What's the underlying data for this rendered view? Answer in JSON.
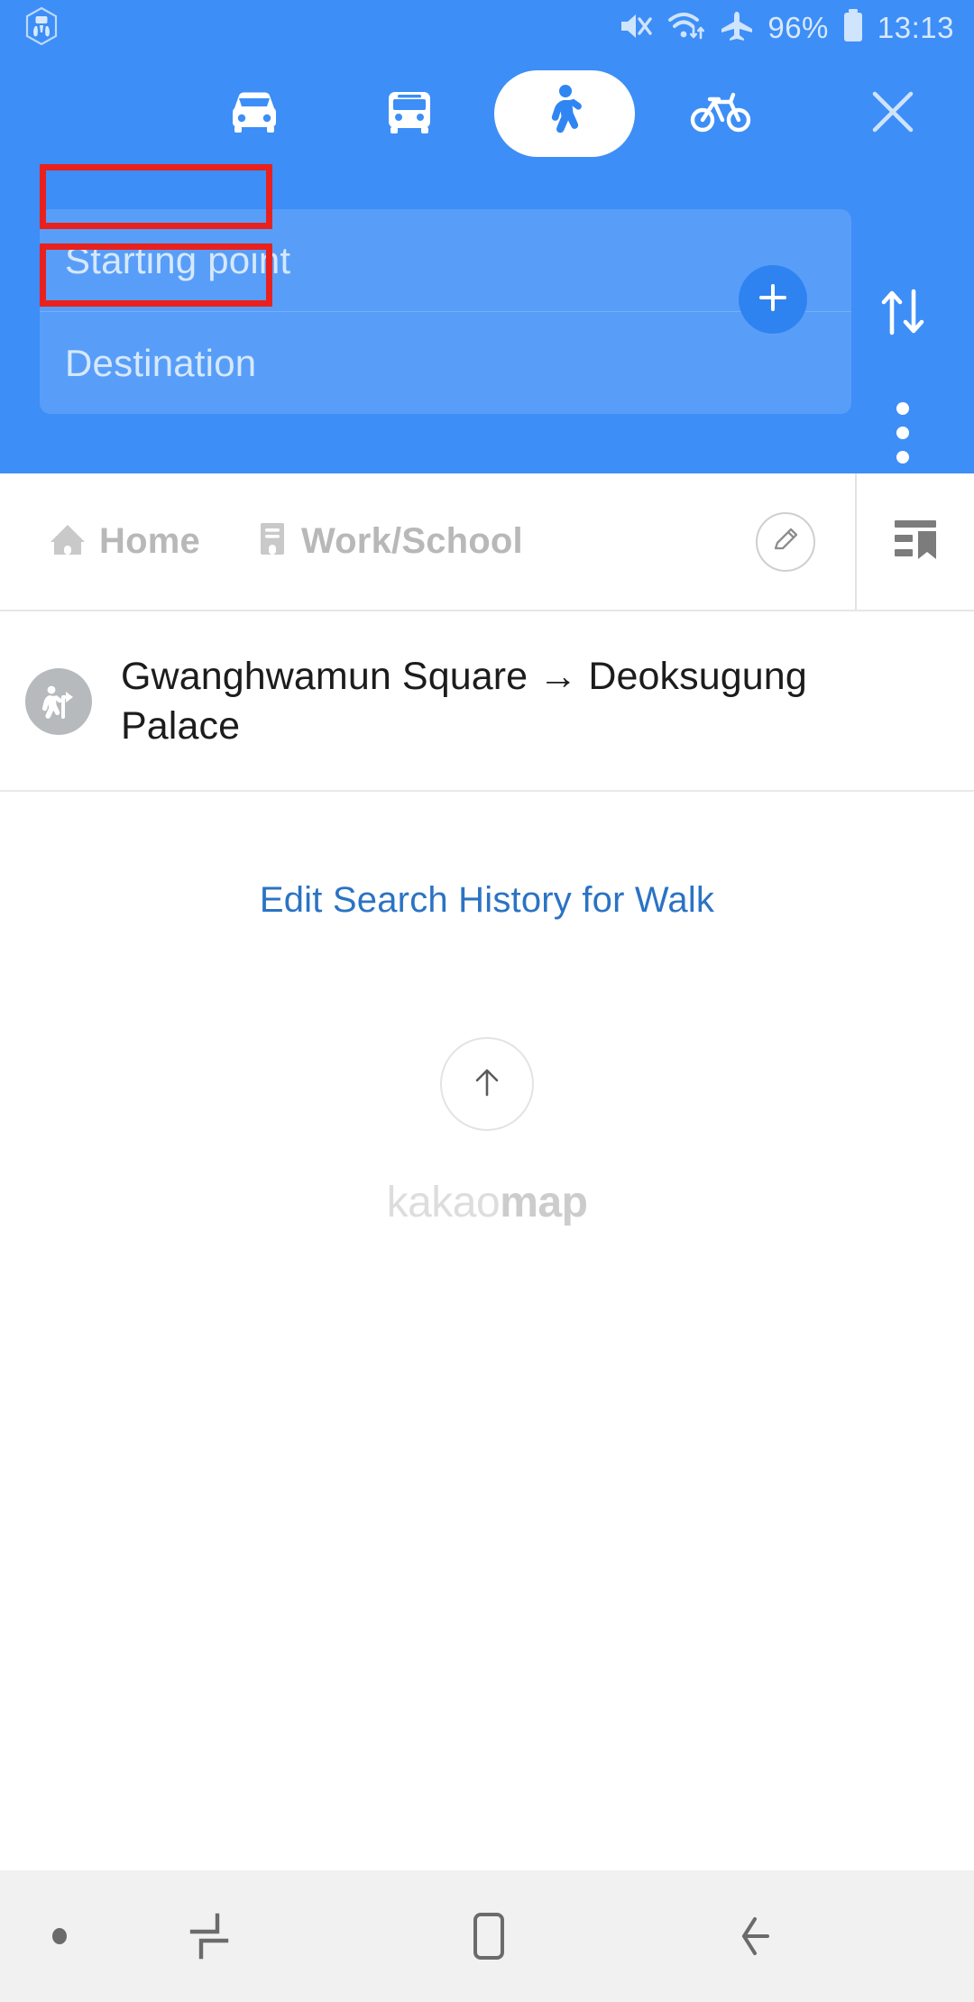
{
  "status_bar": {
    "app_icon": "hexagon-app-icon",
    "mute_icon": "mute-icon",
    "wifi_icon": "wifi-transfer-icon",
    "airplane_icon": "airplane-mode-icon",
    "battery_percent": "96%",
    "battery_icon": "battery-icon",
    "time": "13:13"
  },
  "header": {
    "background_color": "#3d8ef7",
    "modes": [
      {
        "id": "car",
        "icon": "car-icon",
        "label": "Car",
        "selected": false
      },
      {
        "id": "bus",
        "icon": "bus-icon",
        "label": "Bus",
        "selected": false
      },
      {
        "id": "walk",
        "icon": "walk-icon",
        "label": "Walk",
        "selected": true
      },
      {
        "id": "bike",
        "icon": "bike-icon",
        "label": "Bike",
        "selected": false
      }
    ],
    "close_label": "Close",
    "close_icon": "close-icon",
    "inputs": [
      {
        "id": "origin",
        "value": "",
        "placeholder": "Starting point",
        "highlighted": true
      },
      {
        "id": "destination",
        "value": "",
        "placeholder": "Destination",
        "highlighted": true
      }
    ],
    "add_waypoint_label": "+",
    "swap_label": "Swap",
    "more_label": "More options",
    "annotation_color": "#e8211e"
  },
  "shortcuts": {
    "items": [
      {
        "id": "home",
        "label": "Home",
        "icon": "home-icon"
      },
      {
        "id": "work",
        "label": "Work/School",
        "icon": "work-school-icon"
      }
    ],
    "edit_label": "Edit shortcuts",
    "bookmarks_label": "Saved places"
  },
  "history": {
    "items": [
      {
        "icon": "walk-route-icon",
        "text": "Gwanghwamun Square → Deoksugung Palace",
        "origin": "Gwanghwamun Square",
        "destination": "Deoksugung Palace"
      }
    ],
    "edit_history_link": "Edit Search History for Walk",
    "link_color": "#2a73c4"
  },
  "watermark": {
    "arrow_icon": "arrow-up-icon",
    "brand_part1": "kakao",
    "brand_part2": "map"
  },
  "nav_bar": {
    "buttons": [
      {
        "id": "indicator",
        "icon": "dot-indicator-icon",
        "label": "Indicator"
      },
      {
        "id": "recents",
        "icon": "recents-icon",
        "label": "Recents"
      },
      {
        "id": "home",
        "icon": "home-square-icon",
        "label": "Home"
      },
      {
        "id": "back",
        "icon": "back-arrow-icon",
        "label": "Back"
      }
    ]
  }
}
